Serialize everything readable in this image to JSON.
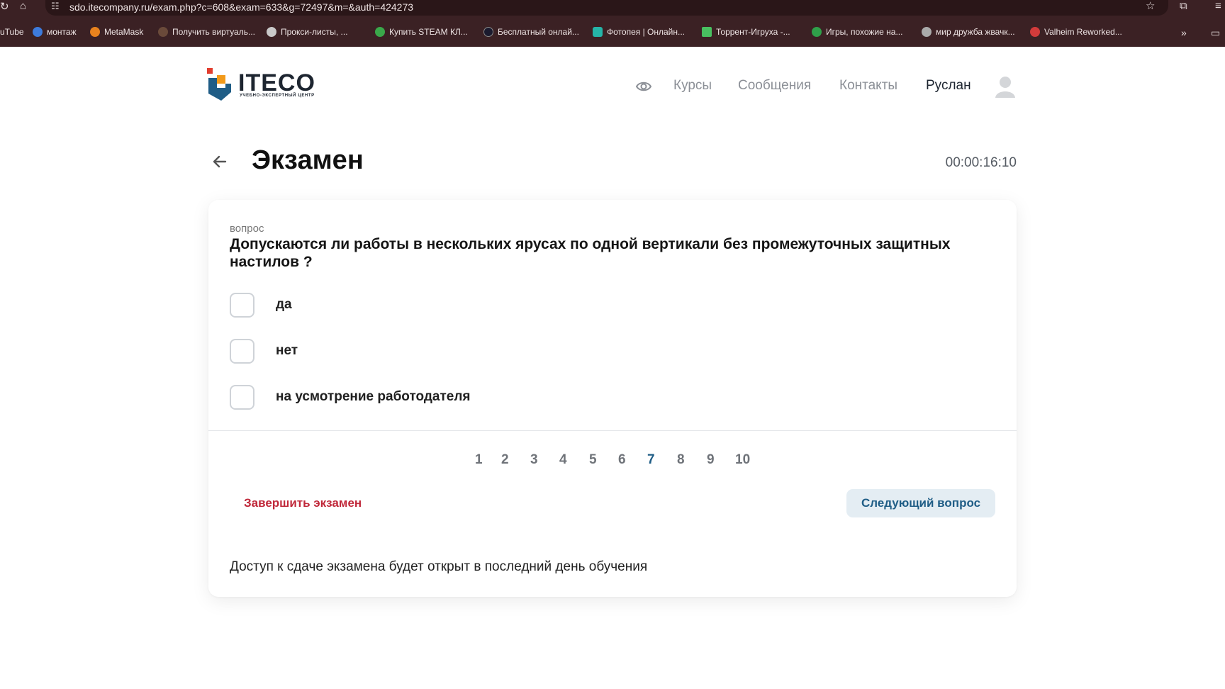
{
  "browser": {
    "url": "sdo.itecompany.ru/exam.php?c=608&exam=633&g=72497&m=&auth=424273",
    "bookmarks": [
      {
        "label": "uTube",
        "color": ""
      },
      {
        "label": "монтаж",
        "color": "#3d7bdc"
      },
      {
        "label": "MetaMask",
        "color": "#e8821e"
      },
      {
        "label": "Получить виртуаль...",
        "color": "#6a4a3a"
      },
      {
        "label": "Прокси-листы, ...",
        "color": "#c9c9c9"
      },
      {
        "label": "Купить STEAM КЛ...",
        "color": "#3aa84a"
      },
      {
        "label": "Бесплатный онлай...",
        "color": "#1a1a2e"
      },
      {
        "label": "Фотопея | Онлайн...",
        "color": "#25b5a8"
      },
      {
        "label": "Торрент-Игруха -...",
        "color": "#48c060"
      },
      {
        "label": "Игры, похожие на...",
        "color": "#2fa04a"
      },
      {
        "label": "мир дружба жвачк...",
        "color": "#aaaaaa"
      },
      {
        "label": "Valheim Reworked...",
        "color": "#d23b3b"
      }
    ]
  },
  "header": {
    "logo_text": "ITECO",
    "logo_sub": "УЧЕБНО-ЭКСПЕРТНЫЙ ЦЕНТР",
    "nav": [
      "Курсы",
      "Сообщения",
      "Контакты"
    ],
    "user_name": "Руслан"
  },
  "page": {
    "title": "Экзамен",
    "timer": "00:00:16:10"
  },
  "question": {
    "label": "вопрос",
    "text": "Допускаются ли работы в нескольких ярусах по одной вертикали без промежуточных защитных настилов ?",
    "options": [
      "да",
      "нет",
      "на усмотрение работодателя"
    ]
  },
  "pagination": {
    "pages": [
      "1",
      "2",
      "3",
      "4",
      "5",
      "6",
      "7",
      "8",
      "9",
      "10"
    ],
    "current": "7"
  },
  "actions": {
    "finish_label": "Завершить экзамен",
    "next_label": "Следующий вопрос"
  },
  "notice": "Доступ к сдаче экзамена будет открыт в последний день обучения",
  "colors": {
    "chrome": "#3b2124",
    "accent": "#1f5d86",
    "danger": "#c0283a",
    "next_bg": "#e4edf3"
  }
}
